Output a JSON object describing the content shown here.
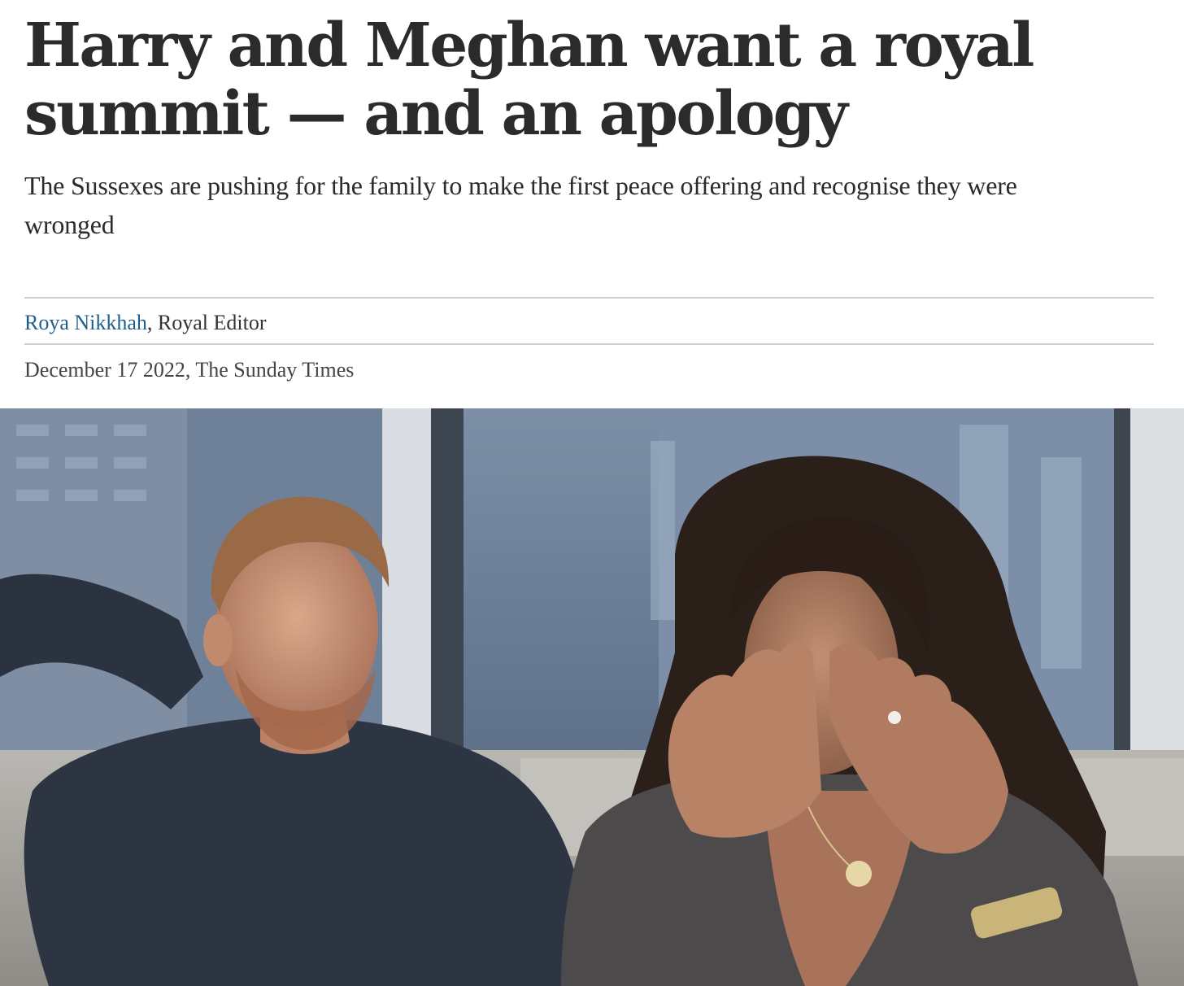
{
  "article": {
    "headline": "Harry and Meghan want a royal summit — and an apology",
    "standfirst": "The Sussexes are pushing for the family to make the first peace offering and recognise they were wronged",
    "byline": {
      "author": "Roya Nikkhah",
      "separator": ", ",
      "role": "Royal Editor"
    },
    "dateline": "December 17 2022, The Sunday Times"
  },
  "colors": {
    "author_link": "#1f5f8b",
    "text": "#2b2b2b",
    "rule": "#d0d0d0"
  }
}
